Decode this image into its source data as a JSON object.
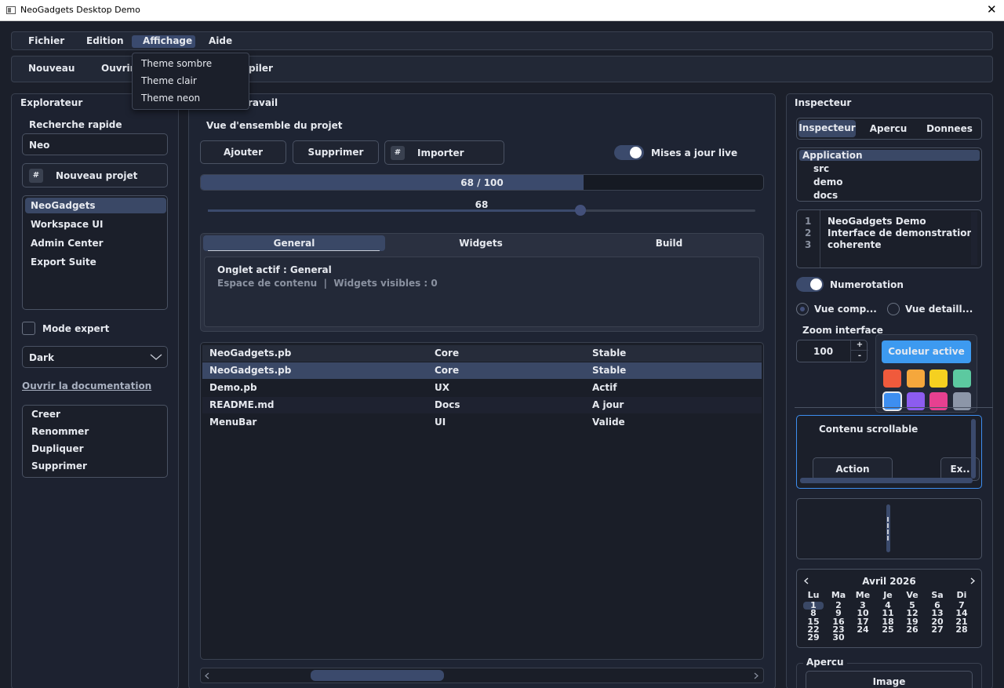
{
  "window": {
    "title": "NeoGadgets Desktop Demo",
    "close_glyph": "✕"
  },
  "menubar": {
    "items": [
      "Fichier",
      "Edition",
      "Affichage",
      "Aide"
    ]
  },
  "view_menu": {
    "items": [
      "Theme sombre",
      "Theme clair",
      "Theme neon"
    ]
  },
  "toolbar": {
    "nouveau": "Nouveau",
    "ouvrir": "Ouvrir",
    "compiler_partial": "piler"
  },
  "explorer": {
    "title": "Explorateur",
    "search_label": "Recherche rapide",
    "search_value": "Neo",
    "new_project_icon": "#",
    "new_project": "Nouveau projet",
    "projects": [
      "NeoGadgets",
      "Workspace UI",
      "Admin Center",
      "Export Suite"
    ],
    "expert_mode": "Mode expert",
    "theme_select": "Dark",
    "doc_link": "Ouvrir la documentation",
    "actions": [
      "Creer",
      "Renommer",
      "Dupliquer",
      "Supprimer"
    ]
  },
  "workspace": {
    "title_partial": "ravail",
    "overview": "Vue d'ensemble du projet",
    "add": "Ajouter",
    "delete": "Supprimer",
    "import_icon": "#",
    "import": "Importer",
    "live_updates": "Mises a jour live",
    "progress_text": "68 / 100",
    "progress_value": 68,
    "progress_max": 100,
    "slider_text": "68",
    "slider_value": 68,
    "tabs": [
      "General",
      "Widgets",
      "Build"
    ],
    "active_tab_text": "Onglet actif : General",
    "content_text": "Espace de contenu  |  Widgets visibles : 0",
    "table": {
      "rows": [
        [
          "NeoGadgets.pb",
          "Core",
          "Stable"
        ],
        [
          "NeoGadgets.pb",
          "Core",
          "Stable"
        ],
        [
          "Demo.pb",
          "UX",
          "Actif"
        ],
        [
          "README.md",
          "Docs",
          "A jour"
        ],
        [
          "MenuBar",
          "UI",
          "Valide"
        ]
      ]
    }
  },
  "inspector": {
    "title": "Inspecteur",
    "tabs": [
      "Inspecteur",
      "Apercu",
      "Donnees"
    ],
    "tree": [
      "Application",
      "src",
      "demo",
      "docs"
    ],
    "lines": [
      {
        "n": "1",
        "text": "NeoGadgets Demo"
      },
      {
        "n": "2",
        "text": "Interface de demonstration"
      },
      {
        "n": "3",
        "text": "coherente"
      }
    ],
    "numbering": "Numerotation",
    "view_compact": "Vue comp...",
    "view_detail": "Vue detaill...",
    "zoom_label": "Zoom interface",
    "zoom_value": "100",
    "spin_up": "+",
    "spin_down": "-",
    "active_color_btn": "Couleur active",
    "colors": [
      "#f05a3c",
      "#f5a73c",
      "#f5d020",
      "#5cc9a0",
      "#3d8ef0",
      "#8c5cf0",
      "#e64090",
      "#8c96a8"
    ],
    "scroll_title": "Contenu scrollable",
    "action_btn": "Action",
    "extra_btn": "Ex..",
    "calendar": {
      "month": "Avril 2026",
      "prev": "‹",
      "next": "›",
      "weekdays": [
        "Lu",
        "Ma",
        "Me",
        "Je",
        "Ve",
        "Sa",
        "Di"
      ],
      "weeks": [
        [
          "1",
          "2",
          "3",
          "4",
          "5",
          "6",
          "7"
        ],
        [
          "8",
          "9",
          "10",
          "11",
          "12",
          "13",
          "14"
        ],
        [
          "15",
          "16",
          "17",
          "18",
          "19",
          "20",
          "21"
        ],
        [
          "22",
          "23",
          "24",
          "25",
          "26",
          "27",
          "28"
        ],
        [
          "29",
          "30",
          "",
          "",
          "",
          "",
          ""
        ]
      ],
      "selected_day": "1"
    },
    "preview_group": "Apercu",
    "image_btn": "Image"
  },
  "colors": {
    "background": "#1b1f2a",
    "panel": "#1d2230",
    "accent": "#3d8ef0",
    "selection": "#3a4866",
    "progress_fill": "#3b4a6c"
  }
}
